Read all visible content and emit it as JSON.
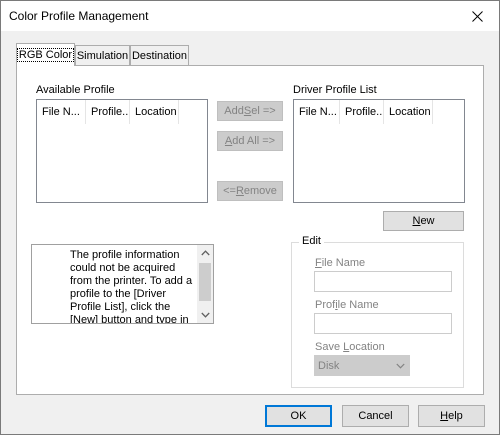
{
  "window": {
    "title": "Color Profile Management",
    "close_icon": "close-icon"
  },
  "tabs": [
    {
      "label": "RGB Color",
      "active": true
    },
    {
      "label": "Simulation",
      "active": false
    },
    {
      "label": "Destination",
      "active": false
    }
  ],
  "available": {
    "label": "Available Profile",
    "columns": [
      "File N...",
      "Profile...",
      "Location"
    ]
  },
  "driver": {
    "label": "Driver Profile List",
    "columns": [
      "File N...",
      "Profile...",
      "Location"
    ]
  },
  "buttons": {
    "add_sel": {
      "before": "Add ",
      "key": "S",
      "after": "el =>"
    },
    "add_all": {
      "before": "",
      "key": "A",
      "after": "dd All =>"
    },
    "remove": {
      "before": "<= ",
      "key": "R",
      "after": "emove"
    },
    "new": {
      "before": "",
      "key": "N",
      "after": "ew"
    }
  },
  "info": {
    "icon": "lightbulb-icon",
    "text": "The profile information could not be acquired from the printer. To add a profile to the [Driver Profile List], click the [New] button and type in the [File Name] and [Profile"
  },
  "edit": {
    "title": "Edit",
    "file_name": {
      "before": "",
      "key": "F",
      "after": "ile Name",
      "value": ""
    },
    "profile_name": {
      "before": "Prof",
      "key": "i",
      "after": "le Name",
      "value": ""
    },
    "save_location": {
      "before": "Save ",
      "key": "L",
      "after": "ocation",
      "selected": "Disk"
    }
  },
  "footer": {
    "ok": "OK",
    "cancel": "Cancel",
    "help": {
      "before": "",
      "key": "H",
      "after": "elp"
    }
  },
  "colors": {
    "focus_blue": "#0078d7",
    "bulb_yellow": "#f7e41a"
  }
}
